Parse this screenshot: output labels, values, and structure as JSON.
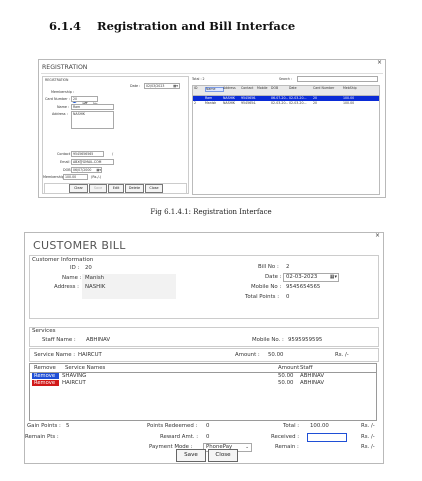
{
  "page_corner_text": "",
  "section": {
    "number": "6.1.4",
    "title": "Registration and Bill Interface"
  },
  "fig_caption": "Fig 6.1.4.1: Registration Interface",
  "registration": {
    "window_title": "REGISTRATION",
    "close": "×",
    "panel_label": "REGISTRATION",
    "date_label": "Date :",
    "date_value": "02/03/2023",
    "membership_label": "Membership :",
    "yes_label": "Yes",
    "no_label": "No",
    "card_number_label": "Card Number :",
    "card_number_value": "20",
    "name_label": "Name :",
    "name_value": "Ram",
    "address_label": "Address :",
    "address_value": "NASHIK",
    "contact_label": "Contact :",
    "contact_value": "9545656565",
    "contact_sep": "/",
    "email_label": "Email :",
    "email_value": "ABX@GMAIL.COM",
    "dob_label": "DOB :",
    "dob_value": "06/07/2000",
    "membership_amt_label": "Membership :",
    "membership_amt_value": "100.00",
    "membership_unit": "(Rs./-)",
    "buttons": [
      "Clear",
      "Save",
      "Edit",
      "Delete",
      "Close"
    ],
    "total_label": "Total :",
    "total_value": "2",
    "search_label": "Search :",
    "grid_headers": [
      "ID",
      "Name",
      "Address",
      "Contact",
      "Mobile",
      "DOB",
      "Date",
      "Card Number",
      "MebShip"
    ],
    "grid_rows": [
      [
        "",
        "Ram",
        "NASHIK",
        "9545656...",
        "",
        "06-07-20...",
        "02-03-20...",
        "20",
        "100.00"
      ],
      [
        "2",
        "Manish",
        "NASHIK",
        "9545654...",
        "",
        "02-03-20...",
        "02-03-20...",
        "20",
        "100.00"
      ]
    ]
  },
  "bill": {
    "window_title": "CUSTOMER BILL",
    "close": "×",
    "customer_info_label": "Customer Information",
    "id_label": "ID :",
    "id_value": "20",
    "name_label": "Name :",
    "name_value": "Manish",
    "address_label": "Address :",
    "address_value": "NASHIK",
    "bill_no_label": "Bill No :",
    "bill_no_value": "2",
    "date_label": "Date :",
    "date_value": "02-03-2023",
    "mobile_label": "Mobile No :",
    "mobile_value": "9545654565",
    "total_points_label": "Total Points :",
    "total_points_value": "0",
    "services_label": "Services",
    "staff_name_label": "Staff Name :",
    "staff_name_value": "ABHINAV",
    "staff_mobile_label": "Mobile No. :",
    "staff_mobile_value": "9595959595",
    "service_name_label": "Service Name :",
    "service_name_value": "HAIRCUT",
    "amount_label": "Amount :",
    "amount_value": "50.00",
    "amount_unit": "Rs. /-",
    "grid_headers": [
      "Remove",
      "Service Names",
      "Amount",
      "Staff"
    ],
    "grid_rows": [
      {
        "remove": "Remove",
        "service": "SHAVING",
        "amount": "50.00",
        "staff": "ABHINAV"
      },
      {
        "remove": "Remove",
        "service": "HAIRCUT",
        "amount": "50.00",
        "staff": "ABHINAV"
      }
    ],
    "gain_points_label": "Gain Points :",
    "gain_points_value": "5",
    "remain_pts_label": "Remain Pts :",
    "remain_pts_value": "",
    "points_redeemed_label": "Points Redeemed :",
    "points_redeemed_value": "0",
    "reward_amt_label": "Reward Amt. :",
    "reward_amt_value": "0",
    "payment_mode_label": "Payment Mode :",
    "payment_mode_value": "PhonePay",
    "total_label": "Total :",
    "total_value": "100.00",
    "received_label": "Received :",
    "received_value": "",
    "remain_label": "Remain :",
    "remain_value": "",
    "rs_unit": "Rs. /-",
    "save_label": "Save",
    "close_label": "Close",
    "colors": {
      "remove_blue": "#1f4fd6",
      "remove_red": "#d11a1a",
      "selected_row": "#0a2bd6"
    }
  }
}
